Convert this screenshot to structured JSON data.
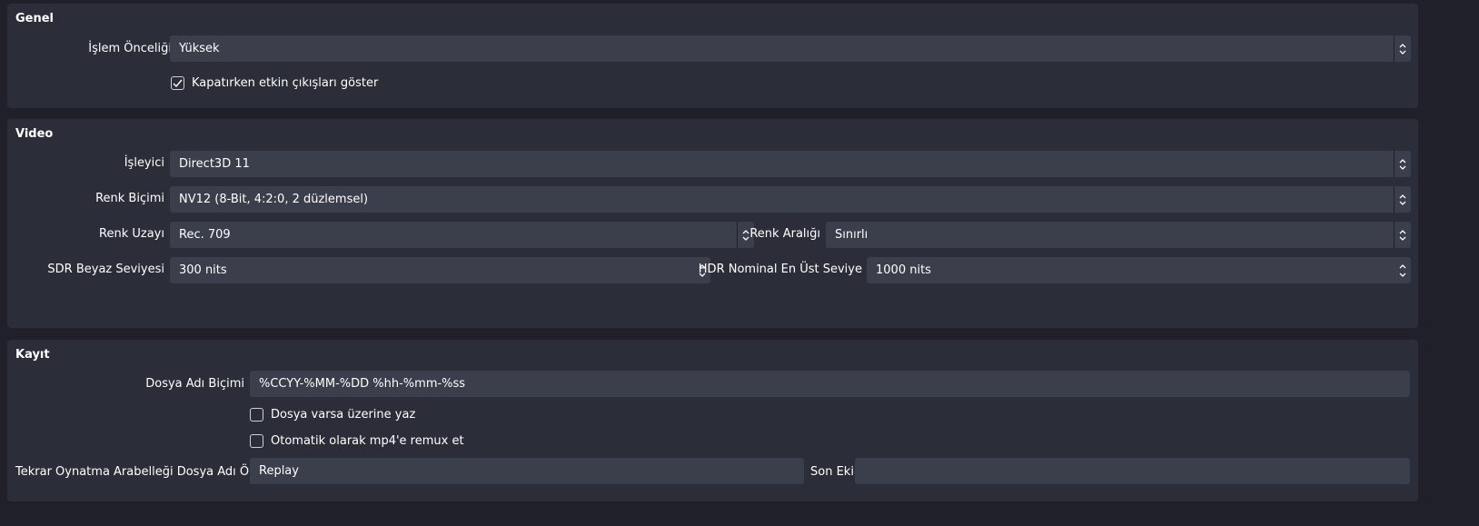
{
  "general": {
    "title": "Genel",
    "priority_label": "İşlem Önceliği",
    "priority_value": "Yüksek",
    "show_active_outputs_label": "Kapatırken etkin çıkışları göster",
    "show_active_outputs_checked": true
  },
  "video": {
    "title": "Video",
    "renderer_label": "İşleyici",
    "renderer_value": "Direct3D 11",
    "color_format_label": "Renk Biçimi",
    "color_format_value": "NV12 (8-Bit, 4:2:0, 2 düzlemsel)",
    "color_space_label": "Renk Uzayı",
    "color_space_value": "Rec. 709",
    "color_range_label": "Renk Aralığı",
    "color_range_value": "Sınırlı",
    "sdr_white_label": "SDR Beyaz Seviyesi",
    "sdr_white_value": "300 nits",
    "hdr_peak_label": "HDR Nominal En Üst Seviye",
    "hdr_peak_value": "1000 nits"
  },
  "recording": {
    "title": "Kayıt",
    "filename_format_label": "Dosya Adı Biçimi",
    "filename_format_value": "%CCYY-%MM-%DD %hh-%mm-%ss",
    "overwrite_label": "Dosya varsa üzerine yaz",
    "overwrite_checked": false,
    "remux_label": "Otomatik olarak mp4'e remux et",
    "remux_checked": false,
    "replay_prefix_label": "Tekrar Oynatma Arabelleği Dosya Adı Ön Eki",
    "replay_prefix_value": "Replay",
    "suffix_label": "Son Eki",
    "suffix_value": ""
  },
  "colors": {
    "background": "#1f2029",
    "panel": "#2b2e39",
    "field": "#3b3e4b",
    "text": "#ffffff"
  }
}
